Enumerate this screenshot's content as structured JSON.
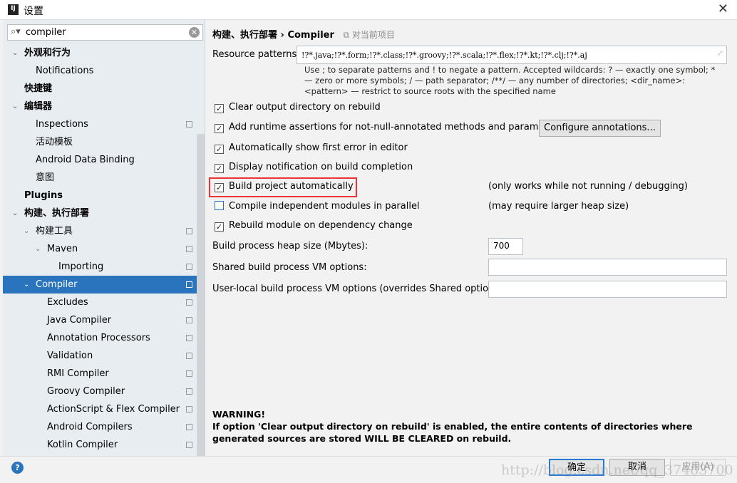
{
  "window": {
    "title": "设置",
    "logo": "IJ",
    "close": "✕"
  },
  "search": {
    "value": "compiler"
  },
  "tree": [
    {
      "label": "外观和行为",
      "level": 0,
      "arrow": "expanded",
      "bold": true
    },
    {
      "label": "Notifications",
      "level": 1
    },
    {
      "label": "快捷键",
      "level": 0,
      "bold": true
    },
    {
      "label": "编辑器",
      "level": 0,
      "arrow": "expanded",
      "bold": true
    },
    {
      "label": "Inspections",
      "level": 1,
      "copy": true
    },
    {
      "label": "活动模板",
      "level": 1
    },
    {
      "label": "Android Data Binding",
      "level": 1
    },
    {
      "label": "意图",
      "level": 1
    },
    {
      "label": "Plugins",
      "level": 0,
      "bold": true
    },
    {
      "label": "构建、执行部署",
      "level": 0,
      "arrow": "expanded",
      "bold": true
    },
    {
      "label": "构建工具",
      "level": 1,
      "arrow": "expanded",
      "copy": true
    },
    {
      "label": "Maven",
      "level": 2,
      "arrow": "expanded",
      "copy": true
    },
    {
      "label": "Importing",
      "level": 3,
      "copy": true
    },
    {
      "label": "Compiler",
      "level": 1,
      "arrow": "expanded",
      "copy": true,
      "selected": true
    },
    {
      "label": "Excludes",
      "level": 2,
      "copy": true
    },
    {
      "label": "Java Compiler",
      "level": 2,
      "copy": true
    },
    {
      "label": "Annotation Processors",
      "level": 2,
      "copy": true
    },
    {
      "label": "Validation",
      "level": 2,
      "copy": true
    },
    {
      "label": "RMI Compiler",
      "level": 2,
      "copy": true
    },
    {
      "label": "Groovy Compiler",
      "level": 2,
      "copy": true
    },
    {
      "label": "ActionScript & Flex Compiler",
      "level": 2,
      "copy": true
    },
    {
      "label": "Android Compilers",
      "level": 2,
      "copy": true
    },
    {
      "label": "Kotlin Compiler",
      "level": 2,
      "copy": true
    }
  ],
  "main": {
    "breadcrumb": {
      "parent": "构建、执行部署",
      "sep": "›",
      "current": "Compiler",
      "scope": "对当前项目"
    },
    "resource_patterns": {
      "label": "Resource patterns:",
      "value": "!?*.java;!?*.form;!?*.class;!?*.groovy;!?*.scala;!?*.flex;!?*.kt;!?*.clj;!?*.aj"
    },
    "help_text": "Use ; to separate patterns and ! to negate a pattern. Accepted wildcards: ? — exactly one symbol; * — zero or more symbols; / — path separator; /**/ — any number of directories; <dir_name>:<pattern> — restrict to source roots with the specified name",
    "checkboxes": [
      {
        "label": "Clear output directory on rebuild",
        "checked": true
      },
      {
        "label": "Add runtime assertions for not-null-annotated methods and parameters",
        "checked": true
      },
      {
        "label": "Automatically show first error in editor",
        "checked": true
      },
      {
        "label": "Display notification on build completion",
        "checked": true
      },
      {
        "label": "Build project automatically",
        "checked": true,
        "note": "(only works while not running / debugging)"
      },
      {
        "label": "Compile independent modules in parallel",
        "checked": false,
        "note": "(may require larger heap size)"
      },
      {
        "label": "Rebuild module on dependency change",
        "checked": true
      }
    ],
    "configure_annotations": "Configure annotations...",
    "heap": {
      "label": "Build process heap size (Mbytes):",
      "value": "700"
    },
    "shared_vm": {
      "label": "Shared build process VM options:",
      "value": ""
    },
    "user_vm": {
      "label": "User-local build process VM options (overrides Shared options):",
      "value": ""
    },
    "warning": {
      "title": "WARNING!",
      "text": "If option 'Clear output directory on rebuild' is enabled, the entire contents of directories where generated sources are stored WILL BE CLEARED on rebuild."
    }
  },
  "footer": {
    "ok": "确定",
    "cancel": "取消",
    "apply": "应用(A)",
    "help": "?",
    "watermark": "http://blog.csdn.net/qq_37483700"
  },
  "colors": {
    "selection": "#2a73bd",
    "highlight_box": "#e33333"
  }
}
